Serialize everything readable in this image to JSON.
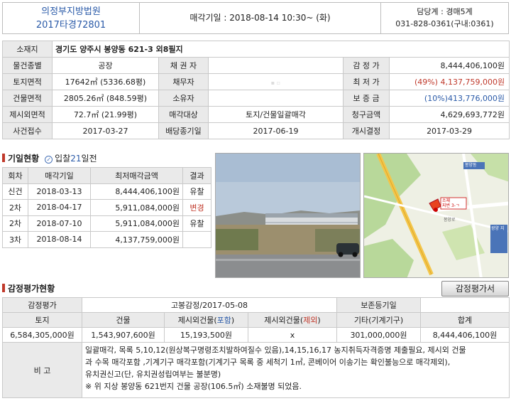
{
  "header": {
    "court": "의정부지방법원",
    "case_no": "2017타경72801",
    "auction_date": "매각기일 : 2018-08-14   10:30~ (화)",
    "dept": "담당계 : 경매5계",
    "phone": "031-828-0361(구내:0361)"
  },
  "info": {
    "location_label": "소재지",
    "location": "경기도 양주시 봉양동 621-3 외8필지",
    "rows": [
      {
        "l1": "물건종별",
        "v1": "공장",
        "l2": "채 권 자",
        "v2": "",
        "l3": "감 정 가",
        "v3": "8,444,406,100원"
      },
      {
        "l1": "토지면적",
        "v1": "17642㎡ (5336.68평)",
        "l2": "채무자",
        "v2": "",
        "l3": "최 저 가",
        "v3": "(49%) 4,137,759,000원"
      },
      {
        "l1": "건물면적",
        "v1": "2805.26㎡ (848.59평)",
        "l2": "소유자",
        "v2": "",
        "l3": "보 증 금",
        "v3": "(10%)413,776,000원"
      },
      {
        "l1": "제시외면적",
        "v1": "72.7㎡ (21.99평)",
        "l2": "매각대상",
        "v2": "토지/건물일괄매각",
        "l3": "청구금액",
        "v3": "4,629,693,772원"
      },
      {
        "l1": "사건접수",
        "v1": "2017-03-27",
        "l2": "배당종기일",
        "v2": "2017-06-19",
        "l3": "개시결정",
        "v3": "2017-03-29"
      }
    ]
  },
  "history": {
    "title": "기일현황",
    "visit_prefix": "입찰",
    "visit_days": "21",
    "visit_suffix": "일전",
    "headers": [
      "회차",
      "매각기일",
      "최저매각금액",
      "결과"
    ],
    "rows": [
      {
        "round": "신건",
        "date": "2018-03-13",
        "amount": "8,444,406,100원",
        "result": "유찰"
      },
      {
        "round": "2차",
        "date": "2018-04-17",
        "amount": "5,911,084,000원",
        "result": "변경"
      },
      {
        "round": "2차",
        "date": "2018-07-10",
        "amount": "5,911,084,000원",
        "result": "유찰"
      },
      {
        "round": "3차",
        "date": "2018-08-14",
        "amount": "4,137,759,000원",
        "result": ""
      }
    ]
  },
  "map": {
    "label_top": "봉양동",
    "label_site": "소재",
    "label_site2": "지번 3-ㄱ",
    "label_side": "광양 지",
    "label_road": "봉양로"
  },
  "appraisal": {
    "section_title": "감정평가현황",
    "button": "감정평가서",
    "r1": [
      "감정평가",
      "고봉감정/2017-05-08",
      "보존등기일",
      ""
    ],
    "headers": [
      "토지",
      "건물",
      "제시외건물",
      "포함",
      "제시외건물",
      "제외",
      "기타(기계기구)",
      "합계"
    ],
    "values": [
      "6,584,305,000원",
      "1,543,907,600원",
      "15,193,500원",
      "x",
      "301,000,000원",
      "8,444,406,100원"
    ],
    "note_label": "비 고",
    "note_lines": [
      "일괄매각, 목록 5,10,12(원상복구명령조치발하여질수 있음),14,15,16,17 농지취득자격증명 제출필요, 제시외 건물",
      "과 수목 매각포함 ,기계기구 매각포함(기계기구 목록 중 세척기 1㎥, 콘베이어 이송기는 확인불능으로 매각제외),",
      "유치권신고(단, 유치권성립여부는 불분명)",
      "※ 위 지상 봉양동 621번지 건물 공장(106.5㎡) 소재불명 되었음."
    ]
  }
}
